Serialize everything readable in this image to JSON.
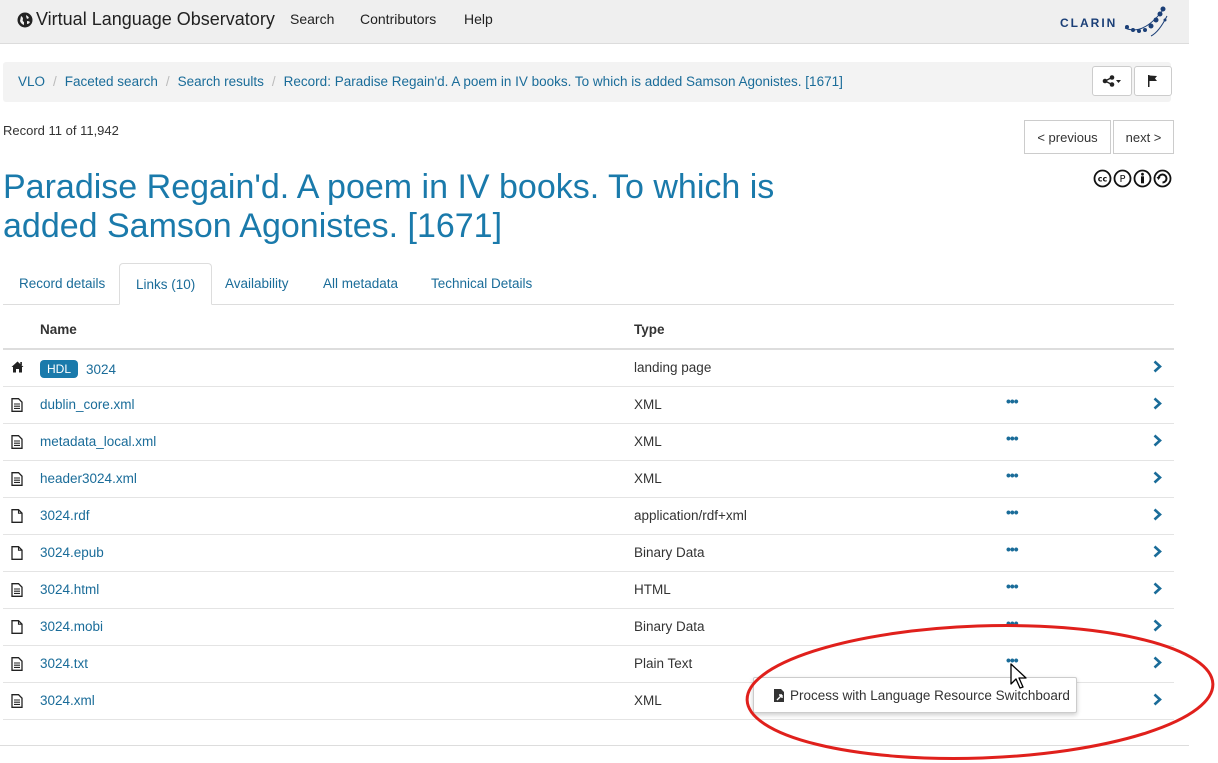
{
  "navbar": {
    "brand": "Virtual Language Observatory",
    "items": [
      "Search",
      "Contributors",
      "Help"
    ],
    "logo_text": "CLARIN"
  },
  "breadcrumb": {
    "items": [
      "VLO",
      "Faceted search",
      "Search results",
      "Record: Paradise Regain'd. A poem in IV books. To which is added Samson Agonistes. [1671]"
    ]
  },
  "record": {
    "count_text": "Record 11 of 11,942",
    "prev_label": "< previous",
    "next_label": "next >",
    "title": "Paradise Regain'd. A poem in IV books. To which is added Samson Agonistes. [1671]"
  },
  "tabs": [
    "Record details",
    "Links (10)",
    "Availability",
    "All metadata",
    "Technical Details"
  ],
  "active_tab": 1,
  "table": {
    "headers": {
      "name": "Name",
      "type": "Type"
    },
    "rows": [
      {
        "icon": "home-icon",
        "badge": "HDL",
        "name": "3024",
        "type": "landing page",
        "more": false
      },
      {
        "icon": "document-text-icon",
        "name": "dublin_core.xml",
        "type": "XML",
        "more": true
      },
      {
        "icon": "document-text-icon",
        "name": "metadata_local.xml",
        "type": "XML",
        "more": true
      },
      {
        "icon": "document-text-icon",
        "name": "header3024.xml",
        "type": "XML",
        "more": true
      },
      {
        "icon": "document-blank-icon",
        "name": "3024.rdf",
        "type": "application/rdf+xml",
        "more": true
      },
      {
        "icon": "document-blank-icon",
        "name": "3024.epub",
        "type": "Binary Data",
        "more": true
      },
      {
        "icon": "document-text-icon",
        "name": "3024.html",
        "type": "HTML",
        "more": true
      },
      {
        "icon": "document-blank-icon",
        "name": "3024.mobi",
        "type": "Binary Data",
        "more": true
      },
      {
        "icon": "document-text-icon",
        "name": "3024.txt",
        "type": "Plain Text",
        "more": true
      },
      {
        "icon": "document-text-icon",
        "name": "3024.xml",
        "type": "XML",
        "more": false
      }
    ],
    "more_label": "•••"
  },
  "popup": {
    "label": "Process with Language Resource Switchboard"
  },
  "colors": {
    "link": "#1a6c99",
    "title": "#1a7aab",
    "annotation": "#e0201c"
  }
}
